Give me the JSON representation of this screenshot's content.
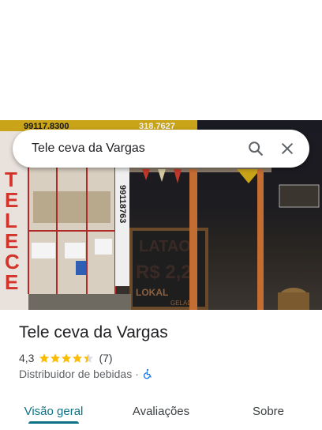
{
  "search": {
    "query": "Tele ceva da Vargas"
  },
  "photo_signs": {
    "phone_left": "99117.8300",
    "phone_right": "318.7627",
    "vertical_sign": "TELECEVA",
    "board_line1": "LATAO",
    "board_line2": "R$ 2,2",
    "board_line3": "LOKAL",
    "board_line4": "GELADO",
    "pillar_number": "99118763"
  },
  "place": {
    "name": "Tele ceva da Vargas",
    "rating": "4,3",
    "stars": 4.3,
    "review_count": "(7)",
    "category": "Distribuidor de bebidas",
    "separator": "·"
  },
  "tabs": [
    {
      "label": "Visão geral",
      "active": true
    },
    {
      "label": "Avaliações",
      "active": false
    },
    {
      "label": "Sobre",
      "active": false
    }
  ],
  "colors": {
    "accent": "#0b7285",
    "star": "#fbbc04"
  }
}
